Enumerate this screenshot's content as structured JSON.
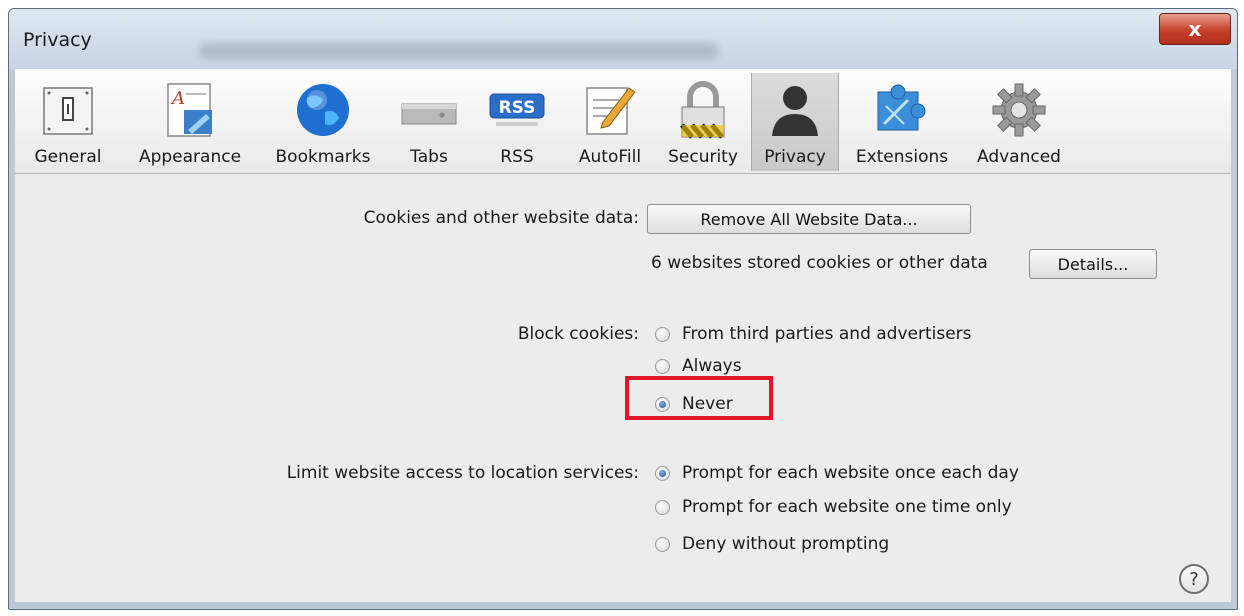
{
  "window": {
    "title": "Privacy",
    "close_symbol": "x"
  },
  "toolbar": {
    "items": [
      {
        "label": "General",
        "icon": "general-switch-icon"
      },
      {
        "label": "Appearance",
        "icon": "appearance-icon"
      },
      {
        "label": "Bookmarks",
        "icon": "globe-icon"
      },
      {
        "label": "Tabs",
        "icon": "tabs-icon"
      },
      {
        "label": "RSS",
        "icon": "rss-icon",
        "badge": "RSS"
      },
      {
        "label": "AutoFill",
        "icon": "autofill-pencil-icon"
      },
      {
        "label": "Security",
        "icon": "lock-icon"
      },
      {
        "label": "Privacy",
        "icon": "person-silhouette-icon",
        "active": true
      },
      {
        "label": "Extensions",
        "icon": "puzzle-icon"
      },
      {
        "label": "Advanced",
        "icon": "gear-icon"
      }
    ]
  },
  "cookies": {
    "label": "Cookies and other website data:",
    "remove_button": "Remove All Website Data...",
    "stored_text": "6 websites stored cookies or other data",
    "details_button": "Details..."
  },
  "block_cookies": {
    "label": "Block cookies:",
    "options": [
      {
        "label": "From third parties and advertisers",
        "checked": false
      },
      {
        "label": "Always",
        "checked": false
      },
      {
        "label": "Never",
        "checked": true
      }
    ]
  },
  "location": {
    "label": "Limit website access to location services:",
    "options": [
      {
        "label": "Prompt for each website once each day",
        "checked": true
      },
      {
        "label": "Prompt for each website one time only",
        "checked": false
      },
      {
        "label": "Deny without prompting",
        "checked": false
      }
    ]
  },
  "help": {
    "symbol": "?"
  },
  "colors": {
    "highlight": "#e0152a",
    "selected_tab": "#cfcfcf",
    "close_button": "#c7402a"
  }
}
